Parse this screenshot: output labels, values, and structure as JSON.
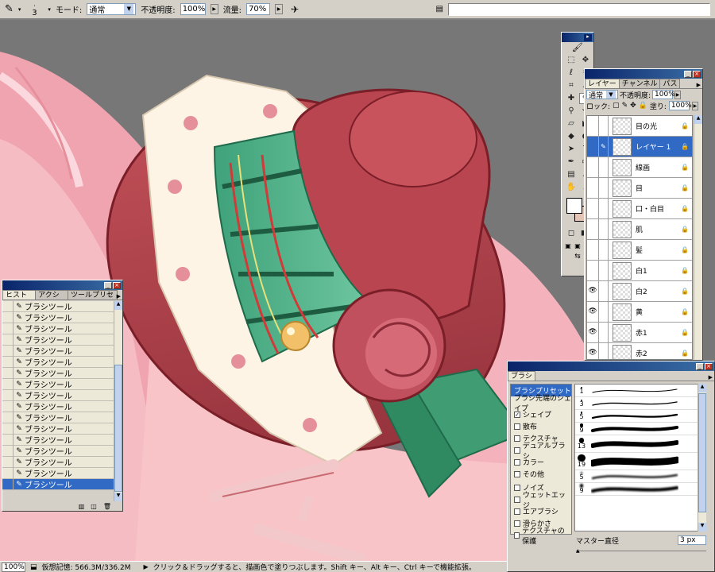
{
  "options_bar": {
    "brush_size": "3",
    "mode_label": "モード:",
    "mode_value": "通常",
    "opacity_label": "不透明度:",
    "opacity_value": "100%",
    "flow_label": "流量:",
    "flow_value": "70%"
  },
  "history_panel": {
    "tabs": [
      "ヒストリー",
      "アクション",
      "ツールプリセット"
    ],
    "items": [
      "ブラシツール",
      "ブラシツール",
      "ブラシツール",
      "ブラシツール",
      "ブラシツール",
      "ブラシツール",
      "ブラシツール",
      "ブラシツール",
      "ブラシツール",
      "ブラシツール",
      "ブラシツール",
      "ブラシツール",
      "ブラシツール",
      "ブラシツール",
      "ブラシツール",
      "ブラシツール",
      "ブラシツール"
    ],
    "selected_index": 16
  },
  "layers_panel": {
    "tabs": [
      "レイヤー",
      "チャンネル",
      "パス"
    ],
    "mode": "通常",
    "opacity_label": "不透明度:",
    "opacity_value": "100%",
    "lock_label": "ロック:",
    "fill_label": "塗り:",
    "fill_value": "100%",
    "layers": [
      {
        "name": "目の光",
        "visible": false
      },
      {
        "name": "レイヤー 1",
        "visible": false,
        "selected": true
      },
      {
        "name": "線画",
        "visible": false
      },
      {
        "name": "目",
        "visible": false
      },
      {
        "name": "口・白目",
        "visible": false
      },
      {
        "name": "肌",
        "visible": false
      },
      {
        "name": "髪",
        "visible": false
      },
      {
        "name": "白1",
        "visible": false
      },
      {
        "name": "白2",
        "visible": true
      },
      {
        "name": "黄",
        "visible": true
      },
      {
        "name": "赤1",
        "visible": true
      },
      {
        "name": "赤2",
        "visible": true
      }
    ]
  },
  "brushes_panel": {
    "tab": "ブラシ",
    "items": [
      {
        "label": "ブラシプリセット",
        "selected": true,
        "has_checkbox": false
      },
      {
        "label": "ブラシ先端のシェイプ",
        "has_checkbox": false
      },
      {
        "label": "シェイプ",
        "has_checkbox": true,
        "checked": true
      },
      {
        "label": "散布",
        "has_checkbox": true
      },
      {
        "label": "テクスチャ",
        "has_checkbox": true
      },
      {
        "label": "デュアルブラシ",
        "has_checkbox": true
      },
      {
        "label": "カラー",
        "has_checkbox": true
      },
      {
        "label": "その他",
        "has_checkbox": true
      },
      {
        "label": "ノイズ",
        "has_checkbox": true
      },
      {
        "label": "ウェットエッジ",
        "has_checkbox": true
      },
      {
        "label": "エアブラシ",
        "has_checkbox": true
      },
      {
        "label": "滑らかさ",
        "has_checkbox": true
      },
      {
        "label": "テクスチャの保護",
        "has_checkbox": true
      }
    ],
    "presets": [
      "1",
      "3",
      "5",
      "9",
      "13",
      "19",
      "5",
      "9"
    ],
    "master_diameter_label": "マスター直径",
    "master_diameter_value": "3 px"
  },
  "status_bar": {
    "zoom": "100%",
    "memory": "仮想記憶: 566.3M/336.2M",
    "hint": "クリック＆ドラッグすると、描画色で塗りつぶします。Shift キー、Alt キー、Ctrl キーで機能拡張。"
  }
}
